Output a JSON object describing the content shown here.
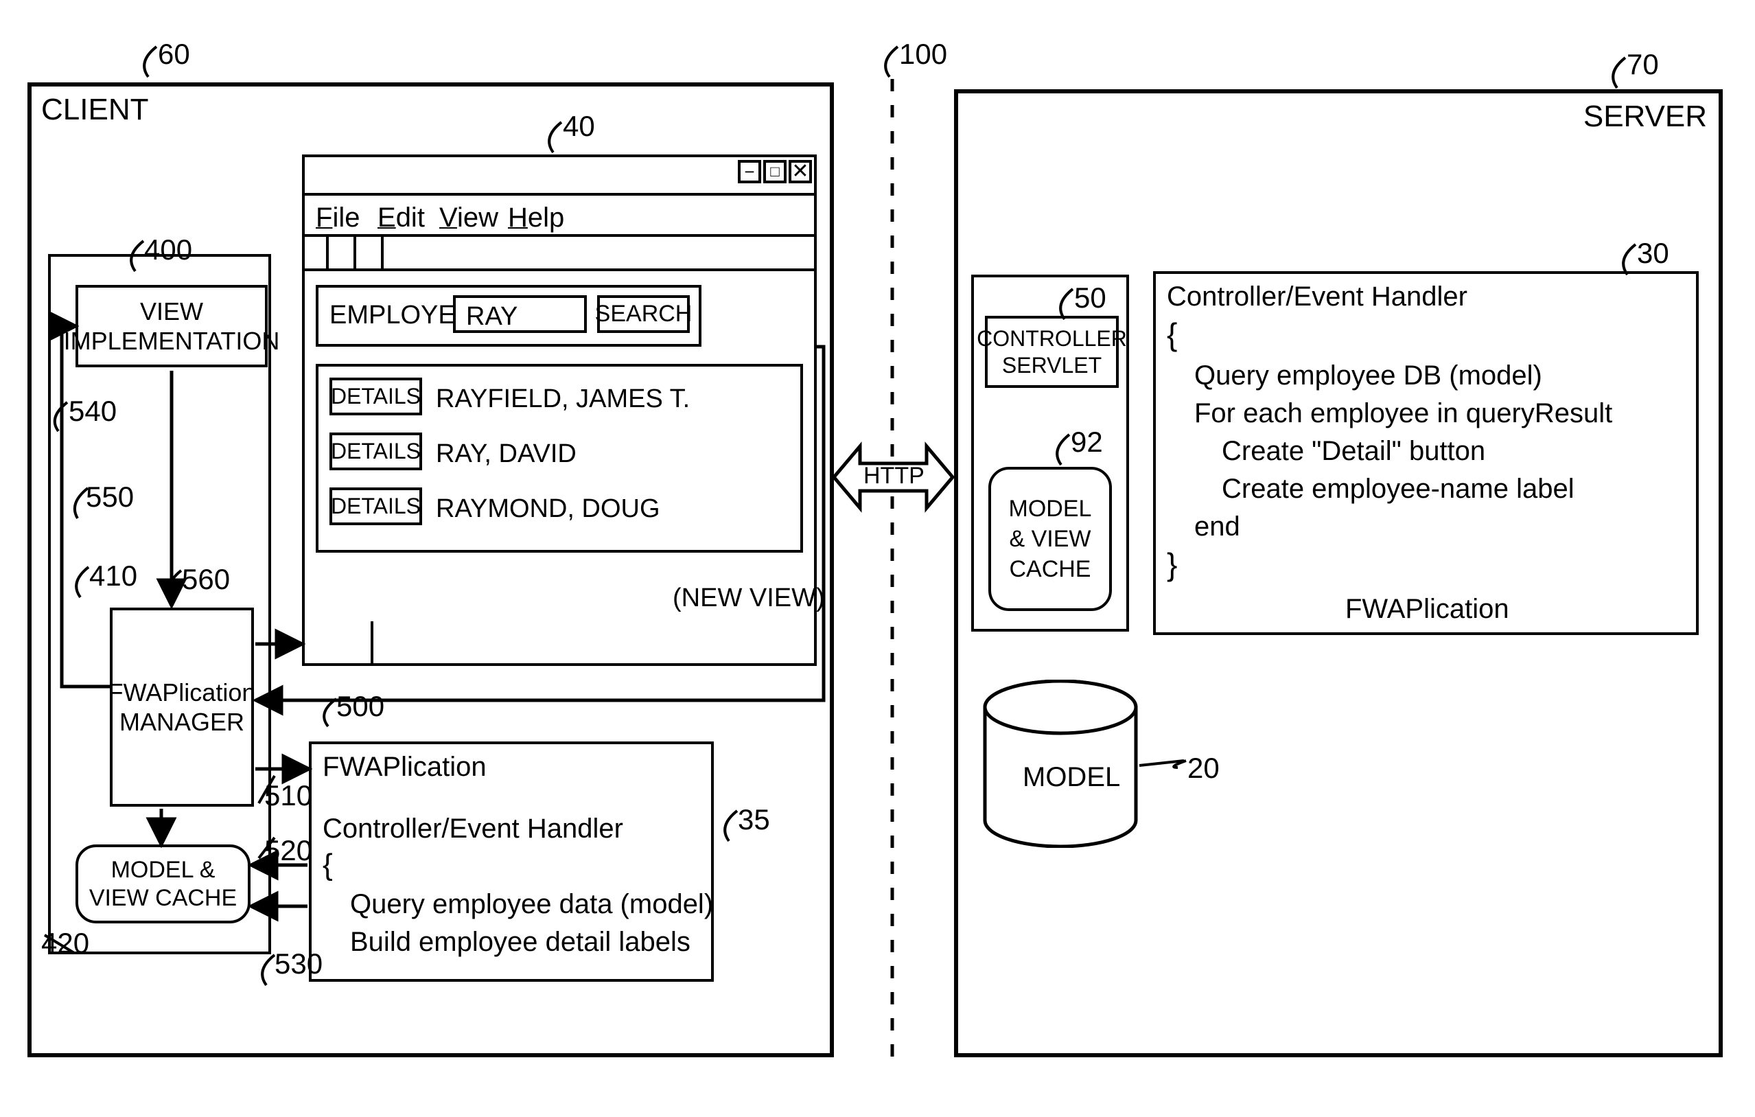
{
  "client": {
    "title": "CLIENT",
    "ref60": "60",
    "viewImpl": {
      "label": "VIEW\nIMPLEMENTATION",
      "ref": "400"
    },
    "fwManager": {
      "label": "FWAPlication\nMANAGER",
      "ref": "410"
    },
    "mvCache": {
      "label": "MODEL &\nVIEW CACHE",
      "ref": "420"
    },
    "arrowRefs": {
      "r500": "500",
      "r510": "510",
      "r520": "520",
      "r530": "530",
      "r540": "540",
      "r550": "550",
      "r560": "560"
    },
    "fwApp": {
      "ref": "35",
      "title": "FWAPlication",
      "subtitle": "Controller/Event Handler",
      "brace_open": "{",
      "line1": "Query employee data (model)",
      "line2": "Build employee detail labels"
    }
  },
  "appWindow": {
    "ref": "40",
    "menu": {
      "file": "File",
      "edit": "Edit",
      "view": "View",
      "help": "Help"
    },
    "winControls": {
      "min": "−",
      "max": "□",
      "close": "×"
    },
    "search": {
      "label": "EMPLOYEE",
      "value": "RAY",
      "button": "SEARCH"
    },
    "results": [
      {
        "button": "DETAILS",
        "name": "RAYFIELD, JAMES T."
      },
      {
        "button": "DETAILS",
        "name": "RAY, DAVID"
      },
      {
        "button": "DETAILS",
        "name": "RAYMOND, DOUG"
      }
    ],
    "newView": "(NEW VIEW)"
  },
  "middle": {
    "ref100": "100",
    "http": "HTTP"
  },
  "server": {
    "title": "SERVER",
    "ref70": "70",
    "controllerServlet": {
      "label": "CONTROLLER\nSERVLET",
      "ref": "50"
    },
    "mvCache": {
      "label": "MODEL\n& VIEW\nCACHE",
      "ref": "92"
    },
    "model": {
      "label": "MODEL",
      "ref": "20"
    },
    "eventHandler": {
      "ref": "30",
      "title": "Controller/Event Handler",
      "brace_open": "{",
      "line1": "Query employee DB (model)",
      "line2": "For each employee in queryResult",
      "line3": "Create \"Detail\" button",
      "line4": "Create employee-name label",
      "line5": "end",
      "brace_close": "}",
      "footer": "FWAPlication"
    }
  }
}
